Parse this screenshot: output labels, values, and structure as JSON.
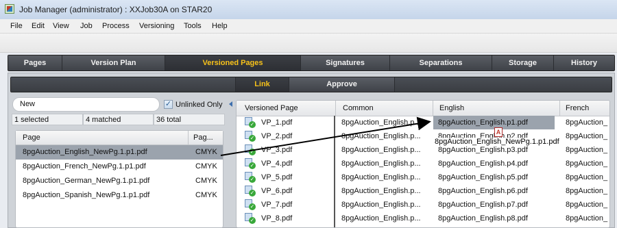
{
  "window": {
    "title": "Job Manager (administrator) : XXJob30A on STAR20"
  },
  "menu": [
    "File",
    "Edit",
    "View",
    "Job",
    "Process",
    "Versioning",
    "Tools",
    "Help"
  ],
  "main_tabs": [
    "Pages",
    "Version Plan",
    "Versioned Pages",
    "Signatures",
    "Separations",
    "Storage",
    "History"
  ],
  "main_tab_active": "Versioned Pages",
  "sub_tabs": [
    "Link",
    "Approve"
  ],
  "sub_tab_active": "Link",
  "search": {
    "value": "New"
  },
  "unlinked_only": {
    "label": "Unlinked Only",
    "checked": true
  },
  "stats": {
    "selected": "1 selected",
    "matched": "4 matched",
    "total": "36 total"
  },
  "left_table": {
    "columns": [
      "Page",
      "Pag..."
    ],
    "rows": [
      {
        "page": "8pgAuction_English_NewPg.1.p1.pdf",
        "colorspace": "CMYK",
        "selected": true
      },
      {
        "page": "8pgAuction_French_NewPg.1.p1.pdf",
        "colorspace": "CMYK",
        "selected": false
      },
      {
        "page": "8pgAuction_German_NewPg.1.p1.pdf",
        "colorspace": "CMYK",
        "selected": false
      },
      {
        "page": "8pgAuction_Spanish_NewPg.1.p1.pdf",
        "colorspace": "CMYK",
        "selected": false
      }
    ]
  },
  "right_table": {
    "columns": [
      "Versioned Page",
      "Common",
      "English",
      "French"
    ],
    "rows": [
      {
        "vp": "VP_1.pdf",
        "common": "8pgAuction_English.p...",
        "english": "8pgAuction_English.p1.pdf",
        "french": "8pgAuction_"
      },
      {
        "vp": "VP_2.pdf",
        "common": "8pgAuction_English.p...",
        "english": "8pgAuction_English.p2.pdf",
        "french": "8pgAuction_"
      },
      {
        "vp": "VP_3.pdf",
        "common": "8pgAuction_English.p...",
        "english": "8pgAuction_English.p3.pdf",
        "french": "8pgAuction_"
      },
      {
        "vp": "VP_4.pdf",
        "common": "8pgAuction_English.p...",
        "english": "8pgAuction_English.p4.pdf",
        "french": "8pgAuction_"
      },
      {
        "vp": "VP_5.pdf",
        "common": "8pgAuction_English.p...",
        "english": "8pgAuction_English.p5.pdf",
        "french": "8pgAuction_"
      },
      {
        "vp": "VP_6.pdf",
        "common": "8pgAuction_English.p...",
        "english": "8pgAuction_English.p6.pdf",
        "french": "8pgAuction_"
      },
      {
        "vp": "VP_7.pdf",
        "common": "8pgAuction_English.p...",
        "english": "8pgAuction_English.p7.pdf",
        "french": "8pgAuction_"
      },
      {
        "vp": "VP_8.pdf",
        "common": "8pgAuction_English.p...",
        "english": "8pgAuction_English.p8.pdf",
        "french": "8pgAuction_"
      }
    ]
  },
  "drag": {
    "label": "8pgAuction_English_NewPg.1.p1.pdf",
    "icon": "pdf-file-icon"
  },
  "colors": {
    "active_tab_text": "#f7c21a",
    "tab_bar": "#3d4046",
    "selection": "#9ba3ad"
  }
}
